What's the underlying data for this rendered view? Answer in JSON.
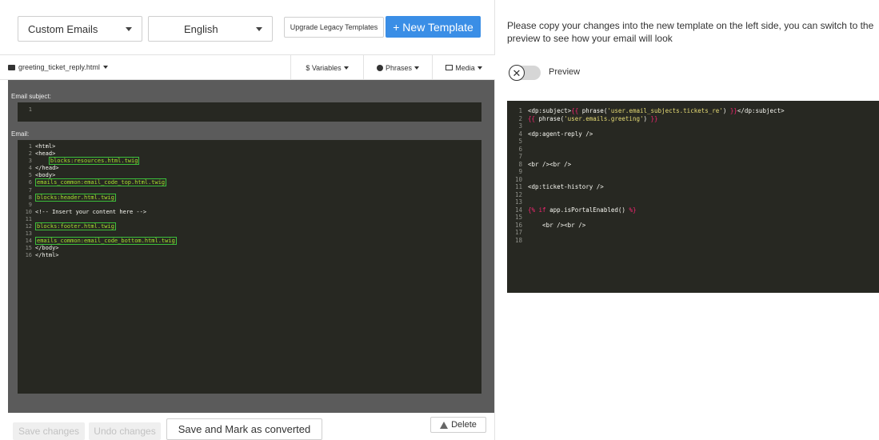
{
  "toolbar": {
    "template_set": "Custom Emails",
    "language": "English",
    "upgrade_label": "Upgrade Legacy Templates",
    "new_template_label": "+ New Template"
  },
  "filebar": {
    "filename": "greeting_ticket_reply.html",
    "variables_label": "$ Variables",
    "phrases_label": "Phrases",
    "media_label": "Media"
  },
  "editor": {
    "subject_label": "Email subject:",
    "email_label": "Email:",
    "subject_lines": [
      {
        "n": "1",
        "text": ""
      }
    ],
    "email_lines": [
      {
        "n": "1",
        "text": "<html>"
      },
      {
        "n": "2",
        "text": "<head>"
      },
      {
        "n": "3",
        "pre": "    ",
        "hl": "blocks:resources.html.twig"
      },
      {
        "n": "4",
        "text": "</head>"
      },
      {
        "n": "5",
        "text": "<body>"
      },
      {
        "n": "6",
        "hl": "emails_common:email_code_top.html.twig"
      },
      {
        "n": "7",
        "text": ""
      },
      {
        "n": "8",
        "hl": "blocks:header.html.twig"
      },
      {
        "n": "9",
        "text": ""
      },
      {
        "n": "10",
        "text": "<!-- Insert your content here -->"
      },
      {
        "n": "11",
        "text": ""
      },
      {
        "n": "12",
        "hl": "blocks:footer.html.twig"
      },
      {
        "n": "13",
        "text": ""
      },
      {
        "n": "14",
        "hl": "emails_common:email_code_bottom.html.twig"
      },
      {
        "n": "15",
        "text": "</body>"
      },
      {
        "n": "16",
        "text": "</html>"
      }
    ]
  },
  "actions": {
    "save_label": "Save changes",
    "undo_label": "Undo changes",
    "mark_label": "Save and Mark as converted",
    "delete_label": "Delete"
  },
  "preview": {
    "message": "Please copy your changes into the new template on the left side, you can switch to the preview to see how your email will look",
    "toggle_label": "Preview",
    "toggle_on": false,
    "lines": [
      {
        "n": "1",
        "parts": [
          [
            "t",
            "<dp:subject>"
          ],
          [
            "d",
            "{{ "
          ],
          [
            "t",
            "phrase("
          ],
          [
            "s",
            "'user.email_subjects.tickets_re'"
          ],
          [
            "t",
            ") "
          ],
          [
            "d",
            "}}"
          ],
          [
            "t",
            "</dp:subject>"
          ]
        ]
      },
      {
        "n": "2",
        "parts": [
          [
            "d",
            "{{ "
          ],
          [
            "t",
            "phrase("
          ],
          [
            "s",
            "'user.emails.greeting'"
          ],
          [
            "t",
            ") "
          ],
          [
            "d",
            "}}"
          ]
        ]
      },
      {
        "n": "3",
        "parts": []
      },
      {
        "n": "4",
        "parts": [
          [
            "t",
            "<dp:agent-reply />"
          ]
        ]
      },
      {
        "n": "5",
        "parts": []
      },
      {
        "n": "6",
        "parts": []
      },
      {
        "n": "7",
        "parts": []
      },
      {
        "n": "8",
        "parts": [
          [
            "t",
            "<br /><br />"
          ]
        ]
      },
      {
        "n": "9",
        "parts": []
      },
      {
        "n": "10",
        "parts": []
      },
      {
        "n": "11",
        "parts": [
          [
            "t",
            "<dp:ticket-history />"
          ]
        ]
      },
      {
        "n": "12",
        "parts": []
      },
      {
        "n": "13",
        "parts": []
      },
      {
        "n": "14",
        "parts": [
          [
            "d",
            "{% "
          ],
          [
            "k",
            "if "
          ],
          [
            "t",
            "app.isPortalEnabled() "
          ],
          [
            "d",
            "%}"
          ]
        ]
      },
      {
        "n": "15",
        "parts": []
      },
      {
        "n": "16",
        "parts": [
          [
            "t",
            "    <br /><br />"
          ]
        ]
      },
      {
        "n": "17",
        "parts": []
      },
      {
        "n": "18",
        "parts": []
      }
    ]
  },
  "colors": {
    "primary": "#3a8ee6",
    "editor_bg": "#272822",
    "highlight_border": "#3bbf3b"
  }
}
